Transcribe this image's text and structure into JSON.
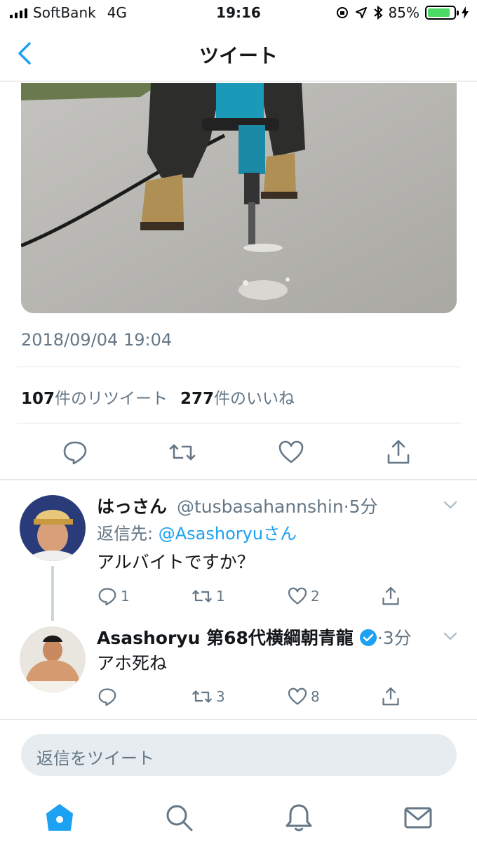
{
  "status_bar": {
    "carrier": "SoftBank",
    "network": "4G",
    "time": "19:16",
    "battery": "85%",
    "battery_level": 0.85
  },
  "nav": {
    "title": "ツイート",
    "back_icon": "chevron-left-icon"
  },
  "tweet": {
    "timestamp": "2018/09/04 19:04",
    "retweet_count": "107",
    "retweet_label": "件のリツイート",
    "like_count": "277",
    "like_label": "件のいいね"
  },
  "replies": [
    {
      "name": "はっさん",
      "handle": "@tusbasahannshin",
      "time": "·5分",
      "reply_to_prefix": "返信先:",
      "reply_to_user": "@Asashoryu",
      "reply_to_suffix": "さん",
      "text": "アルバイトですか？",
      "reply_count": "1",
      "retweet_count": "1",
      "like_count": "2"
    },
    {
      "name": "Asashoryu 第68代横綱朝青龍",
      "handle": "",
      "time": "·3分",
      "verified": true,
      "text": "アホ死ね",
      "reply_count": "",
      "retweet_count": "3",
      "like_count": "8"
    }
  ],
  "compose": {
    "placeholder": "返信をツイート"
  },
  "colors": {
    "accent": "#1da1f2",
    "muted": "#657786",
    "text": "#14171a"
  }
}
